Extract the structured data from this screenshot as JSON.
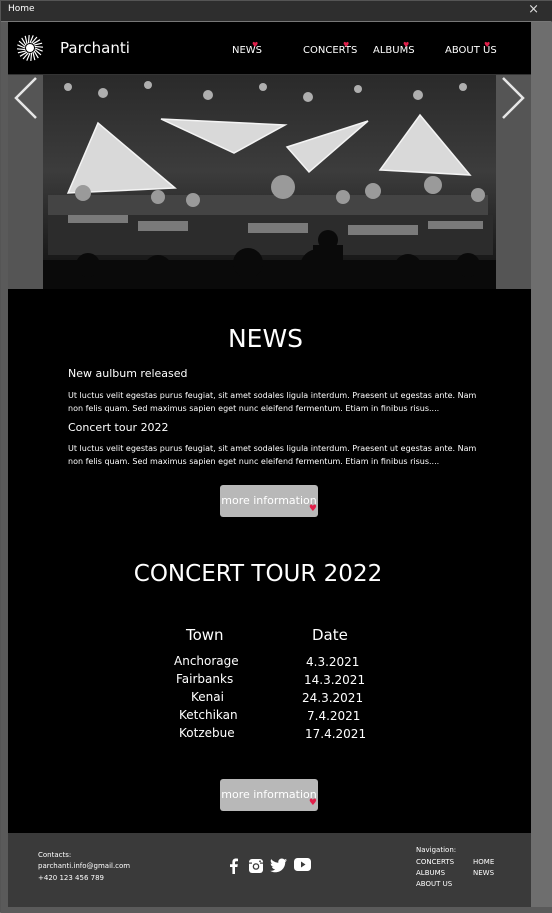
{
  "window": {
    "title": "Home",
    "close_glyph": "×"
  },
  "header": {
    "brand": "Parchanti",
    "nav": [
      {
        "label": "NEWS"
      },
      {
        "label": "CONCERTS"
      },
      {
        "label": "ALBUMS"
      },
      {
        "label": "ABOUT US"
      }
    ],
    "accent": "#e0204a"
  },
  "carousel": {
    "prev_glyph": "‹",
    "next_glyph": "›"
  },
  "news": {
    "heading": "NEWS",
    "items": [
      {
        "title": "New aulbum released",
        "body": "Ut luctus velit egestas purus feugiat, sit amet sodales ligula interdum. Praesent ut egestas ante. Nam non felis quam. Sed maximus sapien eget nunc eleifend fermentum. Etiam in finibus risus...."
      },
      {
        "title": "Concert tour 2022",
        "body": "Ut luctus velit egestas purus feugiat, sit amet sodales ligula interdum. Praesent ut egestas ante. Nam non felis quam. Sed maximus sapien eget nunc eleifend fermentum. Etiam in finibus risus...."
      }
    ],
    "button": "more information"
  },
  "tour": {
    "heading": "CONCERT TOUR 2022",
    "columns": [
      "Town",
      "Date"
    ],
    "rows": [
      {
        "town": "Anchorage",
        "date": "4.3.2021"
      },
      {
        "town": "Fairbanks",
        "date": "14.3.2021"
      },
      {
        "town": "Kenai",
        "date": "24.3.2021"
      },
      {
        "town": "Ketchikan",
        "date": "7.4.2021"
      },
      {
        "town": "Kotzebue",
        "date": "17.4.2021"
      }
    ],
    "button": "more information"
  },
  "footer": {
    "contacts_label": "Contacts:",
    "email": "parchanti.info@gmail.com",
    "phone": "+420 123 456 789",
    "social": [
      "facebook-icon",
      "instagram-icon",
      "twitter-icon",
      "youtube-icon"
    ],
    "nav_label": "Navigation:",
    "nav_col1": [
      "CONCERTS",
      "ALBUMS",
      "ABOUT US"
    ],
    "nav_col2": [
      "HOME",
      "NEWS"
    ]
  }
}
